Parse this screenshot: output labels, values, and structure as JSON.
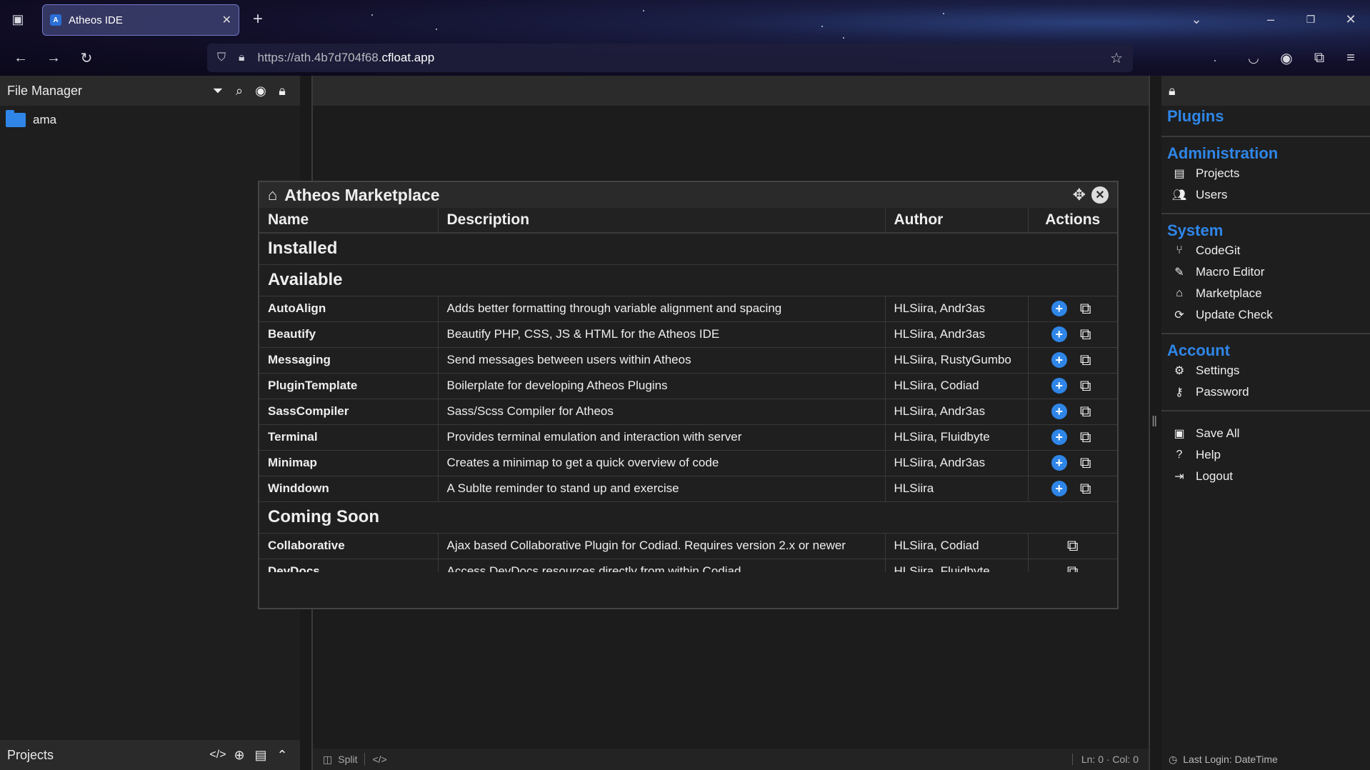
{
  "browser": {
    "tab_title": "Atheos IDE",
    "url_prefix": "https://ath.4b7d704f68.",
    "url_domain": "cfloat.app"
  },
  "file_manager": {
    "title": "File Manager",
    "tree": [
      {
        "label": "ama",
        "icon": "folder-icon"
      }
    ],
    "footer_title": "Projects"
  },
  "editor": {
    "split_label": "Split",
    "position": "Ln: 0 · Col: 0"
  },
  "modal": {
    "title": "Atheos Marketplace",
    "columns": [
      "Name",
      "Description",
      "Author",
      "Actions"
    ],
    "groups": {
      "installed": "Installed",
      "available": "Available",
      "coming_soon": "Coming Soon"
    },
    "available": [
      {
        "name": "AutoAlign",
        "description": "Adds better formatting through variable alignment and spacing",
        "author": "HLSiira, Andr3as"
      },
      {
        "name": "Beautify",
        "description": "Beautify PHP, CSS, JS & HTML for the Atheos IDE",
        "author": "HLSiira, Andr3as"
      },
      {
        "name": "Messaging",
        "description": "Send messages between users within Atheos",
        "author": "HLSiira, RustyGumbo"
      },
      {
        "name": "PluginTemplate",
        "description": "Boilerplate for developing Atheos Plugins",
        "author": "HLSiira, Codiad"
      },
      {
        "name": "SassCompiler",
        "description": "Sass/Scss Compiler for Atheos",
        "author": "HLSiira, Andr3as"
      },
      {
        "name": "Terminal",
        "description": "Provides terminal emulation and interaction with server",
        "author": "HLSiira, Fluidbyte"
      },
      {
        "name": "Minimap",
        "description": "Creates a minimap to get a quick overview of code",
        "author": "HLSiira, Andr3as"
      },
      {
        "name": "Winddown",
        "description": "A Sublte reminder to stand up and exercise",
        "author": "HLSiira"
      }
    ],
    "coming_soon": [
      {
        "name": "Collaborative",
        "description": "Ajax based Collaborative Plugin for Codiad. Requires version 2.x or newer",
        "author": "HLSiira, Codiad"
      },
      {
        "name": "DevDocs",
        "description": "Access DevDocs resources directly from within Codiad",
        "author": "HLSiira, Fluidbyte"
      }
    ]
  },
  "right_panel": {
    "plugins_title": "Plugins",
    "administration_title": "Administration",
    "administration": [
      {
        "label": "Projects",
        "icon": "archive-icon"
      },
      {
        "label": "Users",
        "icon": "users-icon"
      }
    ],
    "system_title": "System",
    "system": [
      {
        "label": "CodeGit",
        "icon": "git-branch-icon"
      },
      {
        "label": "Macro Editor",
        "icon": "magic-wand-icon"
      },
      {
        "label": "Marketplace",
        "icon": "store-icon"
      },
      {
        "label": "Update Check",
        "icon": "sync-icon"
      }
    ],
    "account_title": "Account",
    "account": [
      {
        "label": "Settings",
        "icon": "gears-icon"
      },
      {
        "label": "Password",
        "icon": "key-icon"
      }
    ],
    "misc": [
      {
        "label": "Save All",
        "icon": "save-icon"
      },
      {
        "label": "Help",
        "icon": "help-icon"
      },
      {
        "label": "Logout",
        "icon": "logout-icon"
      }
    ],
    "last_login": "Last Login: DateTime"
  },
  "colors": {
    "accent": "#2f86e8",
    "background": "#1a1a1a"
  }
}
